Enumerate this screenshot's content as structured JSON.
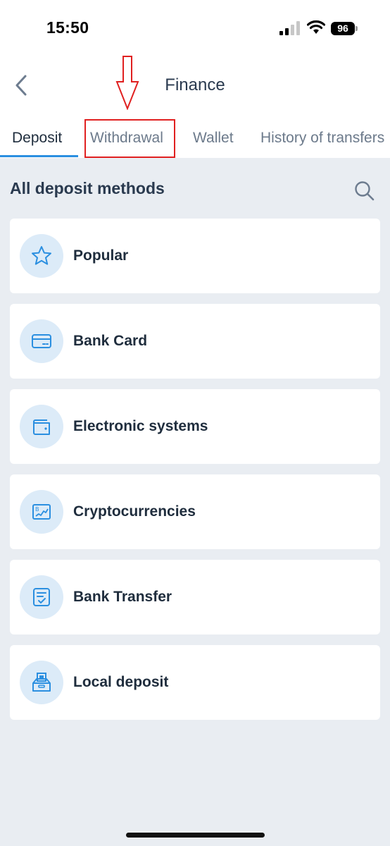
{
  "status_bar": {
    "time": "15:50",
    "battery": "96"
  },
  "header": {
    "title": "Finance"
  },
  "tabs": [
    {
      "label": "Deposit",
      "active": true
    },
    {
      "label": "Withdrawal",
      "active": false
    },
    {
      "label": "Wallet",
      "active": false
    },
    {
      "label": "History of transfers",
      "active": false
    }
  ],
  "section": {
    "title": "All deposit methods"
  },
  "methods": [
    {
      "label": "Popular",
      "icon": "star-icon"
    },
    {
      "label": "Bank Card",
      "icon": "credit-card-icon"
    },
    {
      "label": "Electronic systems",
      "icon": "wallet-icon"
    },
    {
      "label": "Cryptocurrencies",
      "icon": "crypto-chart-icon"
    },
    {
      "label": "Bank Transfer",
      "icon": "document-check-icon"
    },
    {
      "label": "Local deposit",
      "icon": "cash-box-icon"
    }
  ],
  "colors": {
    "accent": "#2b8fe0",
    "icon_bg": "#dcebf8",
    "annotation": "#e02020",
    "page_bg": "#e9edf2"
  }
}
